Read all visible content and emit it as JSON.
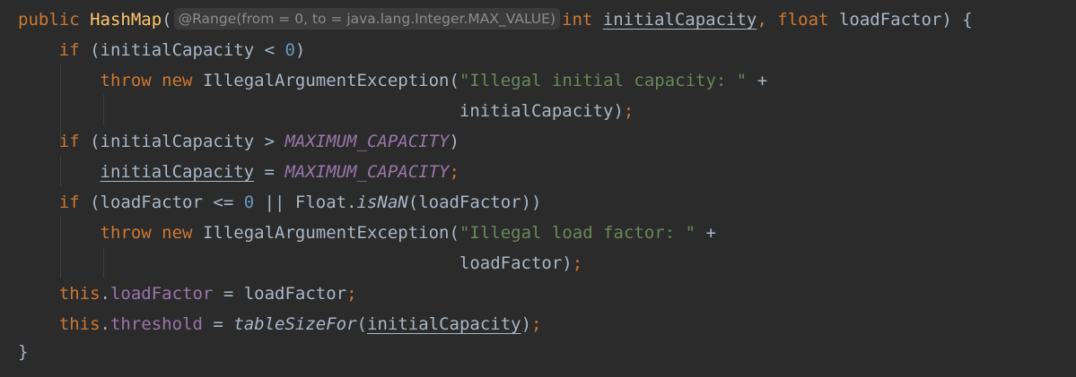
{
  "editor": {
    "line1": {
      "public": "public",
      "method_name": "HashMap",
      "open_paren": "(",
      "inlay_hint": "@Range(from = 0, to = java.lang.Integer.MAX_VALUE)",
      "int": "int",
      "param1": "initialCapacity",
      "comma": ",",
      "float": "float",
      "param2": "loadFactor",
      "close": ") {"
    },
    "line2": {
      "if": "if",
      "cond_open": "(initialCapacity < ",
      "zero": "0",
      "cond_close": ")"
    },
    "line3": {
      "throw": "throw",
      "new": "new",
      "ctor": "IllegalArgumentException(",
      "str": "\"Illegal initial capacity: \"",
      "plus": "+"
    },
    "line4": {
      "arg": "initialCapacity)",
      "semi": ";"
    },
    "line5": {
      "if": "if",
      "cond_open": "(initialCapacity > ",
      "const": "MAXIMUM_CAPACITY",
      "cond_close": ")"
    },
    "line6": {
      "var": "initialCapacity",
      "eq": " = ",
      "const": "MAXIMUM_CAPACITY",
      "semi": ";"
    },
    "line7": {
      "if": "if",
      "cond_open": "(loadFactor <= ",
      "zero": "0",
      "or": " || Float.",
      "is_nan": "isNaN",
      "cond_close": "(loadFactor))"
    },
    "line8": {
      "throw": "throw",
      "new": "new",
      "ctor": "IllegalArgumentException(",
      "str": "\"Illegal load factor: \"",
      "plus": "+"
    },
    "line9": {
      "arg": "loadFactor)",
      "semi": ";"
    },
    "line10": {
      "this": "this",
      "dot": ".",
      "field": "loadFactor",
      "eq": " = loadFactor",
      "semi": ";"
    },
    "line11": {
      "this": "this",
      "dot": ".",
      "field": "threshold",
      "eq": " = ",
      "call": "tableSizeFor",
      "open": "(",
      "arg": "initialCapacity",
      "close": ")",
      "semi": ";"
    },
    "line12": {
      "brace": "}"
    }
  },
  "colors": {
    "background": "#2b2b2b",
    "keyword": "#cc7832",
    "method": "#ffc66d",
    "number": "#6897bb",
    "string": "#6a8759",
    "constant": "#9876aa",
    "text": "#a9b7c6",
    "inlay_hint": "#8c8c8c"
  }
}
